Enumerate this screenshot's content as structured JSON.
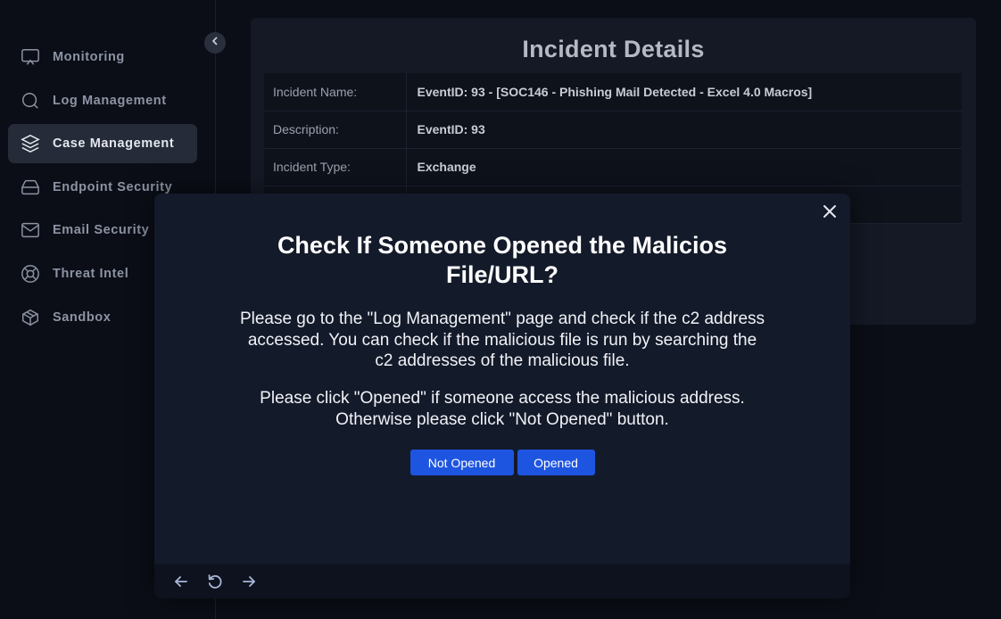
{
  "sidebar": {
    "items": [
      {
        "label": "Monitoring",
        "icon": "monitor-icon",
        "active": false
      },
      {
        "label": "Log Management",
        "icon": "search-icon",
        "active": false
      },
      {
        "label": "Case Management",
        "icon": "layers-icon",
        "active": true
      },
      {
        "label": "Endpoint Security",
        "icon": "hard-drive-icon",
        "active": false
      },
      {
        "label": "Email Security",
        "icon": "mail-icon",
        "active": false
      },
      {
        "label": "Threat Intel",
        "icon": "lifebuoy-icon",
        "active": false
      },
      {
        "label": "Sandbox",
        "icon": "box-icon",
        "active": false
      }
    ],
    "collapse_icon": "chevron-left-icon"
  },
  "incident": {
    "title": "Incident Details",
    "rows": [
      {
        "label": "Incident Name:",
        "value": "EventID: 93 - [SOC146 - Phishing Mail Detected - Excel 4.0 Macros]"
      },
      {
        "label": "Description:",
        "value": "EventID: 93"
      },
      {
        "label": "Incident Type:",
        "value": "Exchange"
      },
      {
        "label": "",
        "value": ""
      }
    ]
  },
  "modal": {
    "title": "Check If Someone Opened the Malicios File/URL?",
    "paragraph1": "Please go to the \"Log Management\" page and check if the c2 address accessed. You can check if the malicious file is run by searching the c2 addresses of the malicious file.",
    "paragraph2": "Please click \"Opened\" if someone access the malicious address. Otherwise please click \"Not Opened\" button.",
    "buttons": {
      "not_opened": "Not Opened",
      "opened": "Opened"
    },
    "close_icon": "close-icon",
    "footer_icons": [
      "arrow-left-icon",
      "refresh-icon",
      "arrow-right-icon"
    ]
  },
  "colors": {
    "background": "#0b0e17",
    "accent": "#1e55e0",
    "modal_bg": "#131a2a",
    "active_nav": "#252b38"
  }
}
